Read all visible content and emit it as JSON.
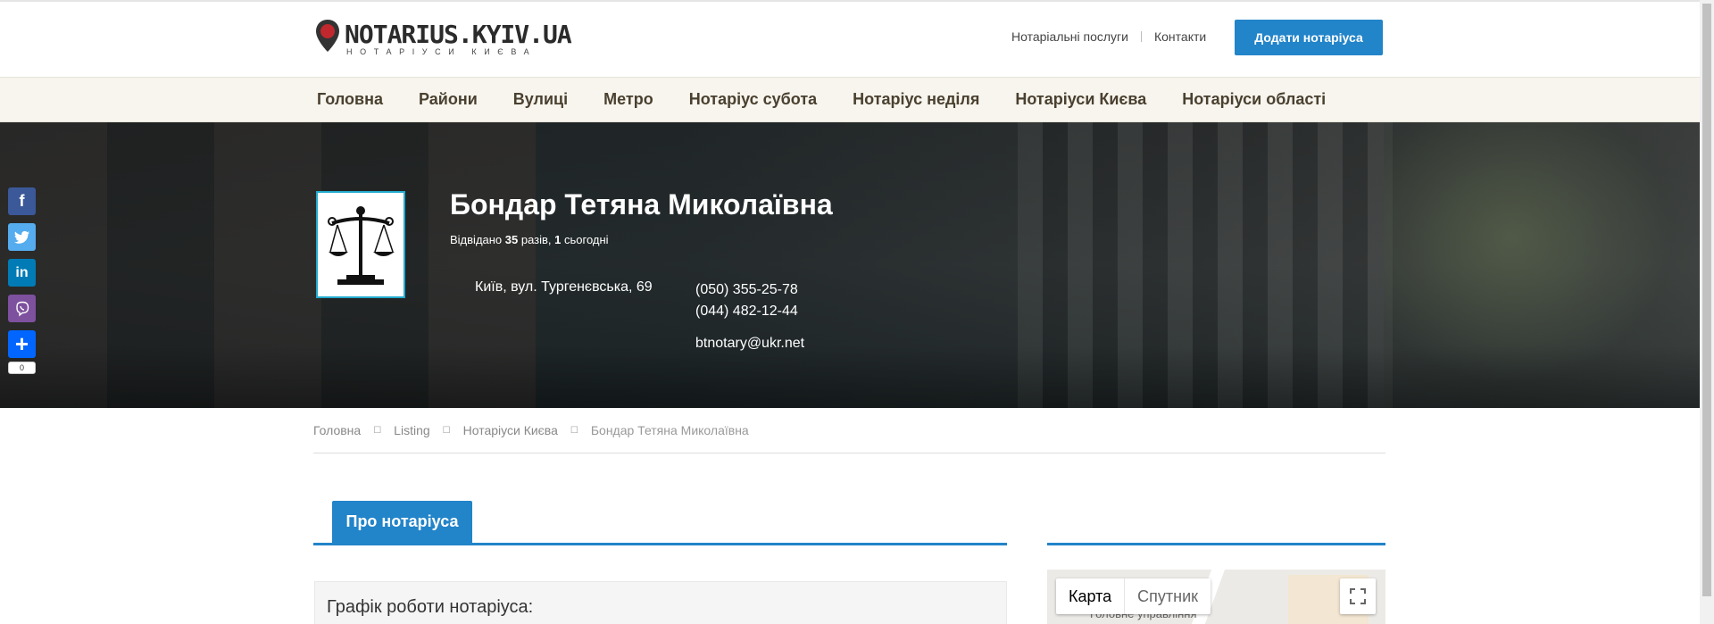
{
  "header": {
    "logo_title": "NOTARIUS.KYIV.UA",
    "logo_subtitle": "НОТАРІУСИ КИЄВА",
    "links": [
      "Нотаріальні послуги",
      "Контакти"
    ],
    "add_button": "Додати нотаріуса"
  },
  "nav": {
    "items": [
      "Головна",
      "Райони",
      "Вулиці",
      "Метро",
      "Нотаріус субота",
      "Нотаріус неділя",
      "Нотаріуси Києва",
      "Нотаріуси області"
    ]
  },
  "profile": {
    "name": "Бондар Тетяна Миколаївна",
    "visits_prefix": "Відвідано ",
    "visits_total": "35",
    "visits_mid": " разів, ",
    "visits_today": "1",
    "visits_suffix": " сьогодні",
    "address": "Київ, вул. Тургенєвська, 69",
    "phone1": "(050) 355-25-78",
    "phone2": "(044) 482-12-44",
    "email": "btnotary@ukr.net"
  },
  "social": {
    "icons": [
      "facebook-icon",
      "twitter-icon",
      "linkedin-icon",
      "viber-icon",
      "share-more-icon"
    ],
    "share_count": "0"
  },
  "breadcrumb": {
    "items": [
      "Головна",
      "Listing",
      "Нотаріуси Києва",
      "Бондар Тетяна Миколаївна"
    ]
  },
  "tabs": {
    "active": "Про нотаріуса"
  },
  "schedule": {
    "title": "Графік роботи нотаріуса:"
  },
  "map": {
    "map_label": "Карта",
    "satellite_label": "Спутник",
    "place_label": "Головне управління"
  },
  "colors": {
    "accent": "#2284c9",
    "nav_bg": "#f7f5ed"
  }
}
